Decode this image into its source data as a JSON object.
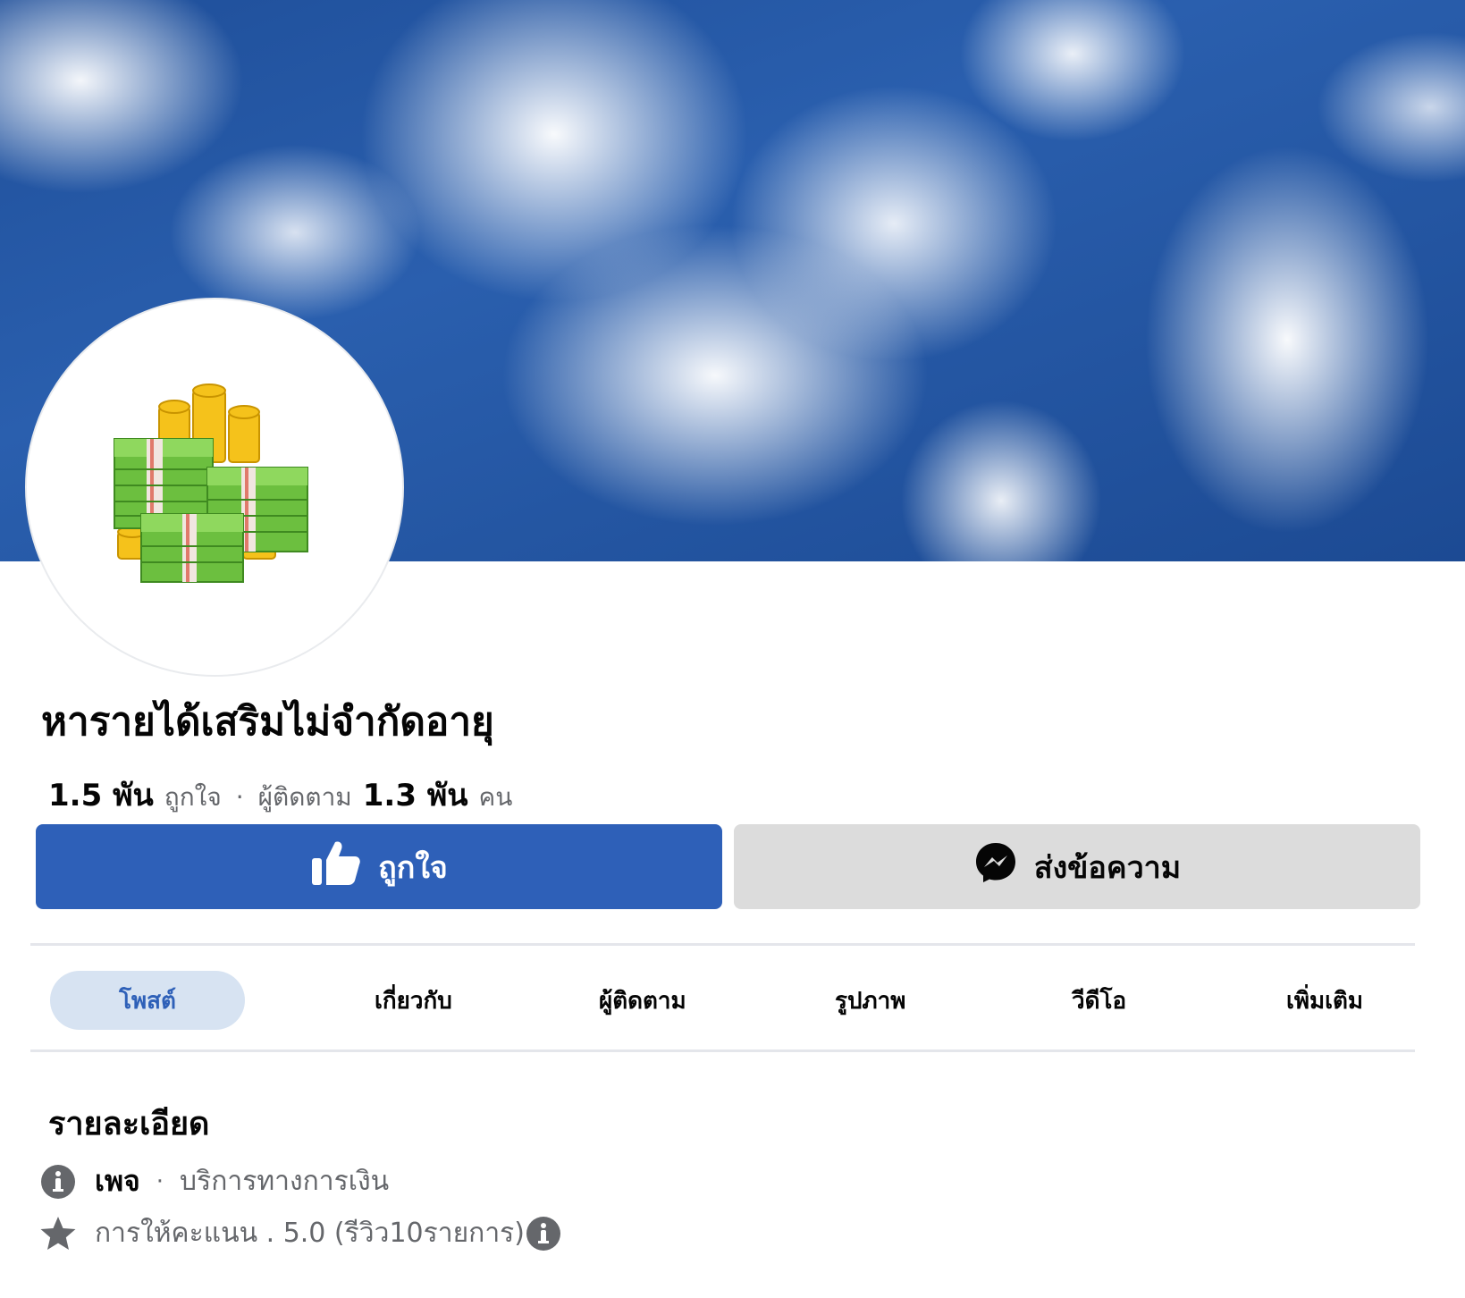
{
  "page": {
    "name": "หารายได้เสริมไม่จำกัดอายุ",
    "likes_count": "1.5 พัน",
    "likes_label": "ถูกใจ",
    "separator": "·",
    "followers_label": "ผู้ติดตาม",
    "followers_count": "1.3 พัน",
    "followers_unit": "คน"
  },
  "actions": {
    "like_label": "ถูกใจ",
    "message_label": "ส่งข้อความ"
  },
  "tabs": [
    {
      "label": "โพสต์",
      "active": true
    },
    {
      "label": "เกี่ยวกับ",
      "active": false
    },
    {
      "label": "ผู้ติดตาม",
      "active": false
    },
    {
      "label": "รูปภาพ",
      "active": false
    },
    {
      "label": "วีดีโอ",
      "active": false
    },
    {
      "label": "เพิ่มเติม",
      "active": false
    }
  ],
  "details": {
    "title": "รายละเอียด",
    "page_kind": "เพจ",
    "separator": "·",
    "category": "บริการทางการเงิน",
    "rating_text": "การให้คะแนน . 5.0 (รีวิว10รายการ)"
  },
  "colors": {
    "primary": "#2e60b8",
    "active_tab_bg": "#d7e3f2",
    "secondary_button": "#dcdcdc",
    "muted_text": "#65676b",
    "icon_gray": "#65676b"
  },
  "icons": {
    "like_button": "thumbs-up-icon",
    "message_button": "messenger-icon",
    "category": "info-icon",
    "rating": "star-icon",
    "rating_info": "info-icon"
  }
}
